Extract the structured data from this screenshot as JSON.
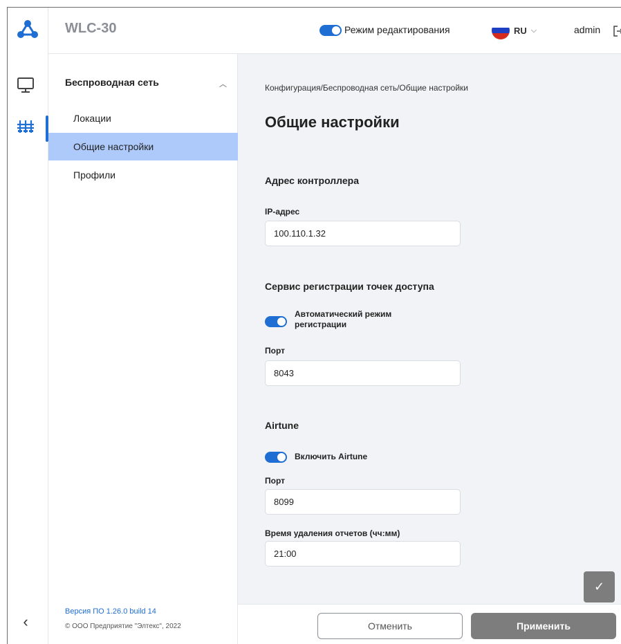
{
  "app": {
    "title": "WLC-30"
  },
  "header": {
    "edit_mode_label": "Режим редактирования",
    "language": "RU",
    "user": "admin",
    "flag_colors": [
      "#ffffff",
      "#1c3fc4",
      "#d52b1e"
    ]
  },
  "rail": {
    "icons": [
      "logo-icon",
      "monitor-icon",
      "wireless-config-icon",
      "collapse-icon"
    ],
    "accent": "#1f6ed4"
  },
  "sidebar": {
    "section_title": "Беспроводная сеть",
    "items": [
      {
        "label": "Локации",
        "active": false
      },
      {
        "label": "Общие настройки",
        "active": true
      },
      {
        "label": "Профили",
        "active": false
      }
    ],
    "version": "Версия ПО 1.26.0 build 14",
    "copyright": "© ООО Предприятие \"Элтекс\", 2022"
  },
  "main": {
    "breadcrumb": "Конфигурация/Беспроводная сеть/Общие настройки",
    "title": "Общие настройки",
    "controller": {
      "title": "Адрес контроллера",
      "ip_label": "IP-адрес",
      "ip_value": "100.110.1.32"
    },
    "registration": {
      "title": "Сервис регистрации точек доступа",
      "auto_label": "Автоматический режим регистрации",
      "auto_enabled": true,
      "port_label": "Порт",
      "port_value": "8043"
    },
    "airtune": {
      "title": "Airtune",
      "enable_label": "Включить Airtune",
      "enabled": true,
      "port_label": "Порт",
      "port_value": "8099",
      "report_time_label": "Время удаления отчетов (чч:мм)",
      "report_time_value": "21:00"
    }
  },
  "actions": {
    "cancel": "Отменить",
    "apply": "Применить"
  }
}
